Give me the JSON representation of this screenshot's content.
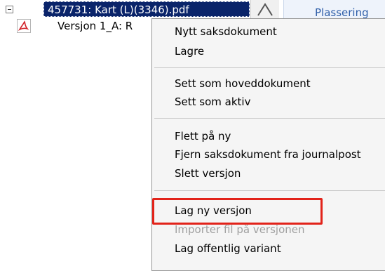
{
  "tree": {
    "document_node": "457731: Kart (L)(3346).pdf",
    "version_node": "Versjon 1_A: R",
    "file_icon": "pdf-icon"
  },
  "tab": {
    "label": "Plassering"
  },
  "context_menu": {
    "items": [
      {
        "label": "Nytt saksdokument",
        "enabled": true
      },
      {
        "label": "Lagre",
        "enabled": true
      },
      {
        "label": "Sett som hoveddokument",
        "enabled": true
      },
      {
        "label": "Sett som aktiv",
        "enabled": true
      },
      {
        "label": "Flett på ny",
        "enabled": true
      },
      {
        "label": "Fjern saksdokument fra journalpost",
        "enabled": true
      },
      {
        "label": "Slett versjon",
        "enabled": true
      },
      {
        "label": "Lag ny versjon",
        "enabled": true,
        "highlighted": true
      },
      {
        "label": "Importer fil på versjonen",
        "enabled": false
      },
      {
        "label": "Lag offentlig variant",
        "enabled": true
      }
    ]
  },
  "colors": {
    "selection": "#0a246a",
    "highlight_box": "#e2231a",
    "disabled_text": "#a0a0a0"
  }
}
